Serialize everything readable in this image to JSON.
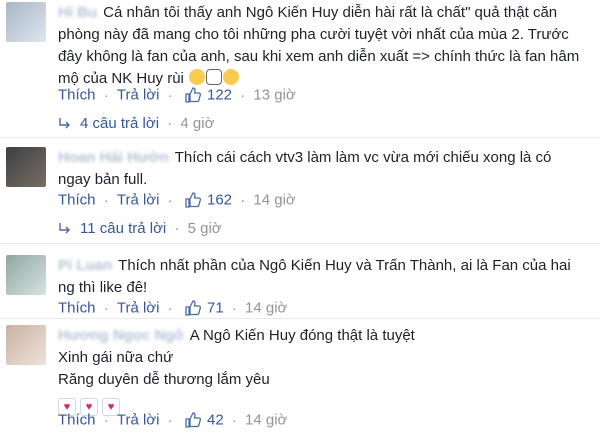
{
  "labels": {
    "like": "Thích",
    "reply": "Trả lời",
    "sep": "·"
  },
  "comments": [
    {
      "author": "Hi Bu",
      "lines": [
        "Cá nhân tôi thấy anh Ngô Kiến Huy diễn hài rất là chất\" quả thật căn",
        "phòng này đã mang cho tôi những pha cười tuyệt vời nhất của mùa 2. Trước",
        "đây không là fan của anh, sau khi xem anh diễn xuất => chính thức là fan hâm",
        "mộ của NK Huy rùi"
      ],
      "likes": "122",
      "time": "13 giờ",
      "replies": "4 câu trả lời",
      "replies_time": "4 giờ"
    },
    {
      "author": "Hoan Hải Hườn",
      "lines": [
        "Thích cái cách vtv3 làm làm vc vừa mới chiếu xong là có",
        "ngay bản full."
      ],
      "likes": "162",
      "time": "14 giờ",
      "replies": "11 câu trả lời",
      "replies_time": "5 giờ"
    },
    {
      "author": "Pi Luan",
      "lines": [
        "Thích nhất phần của Ngô Kiến Huy và Trấn Thành, ai là Fan của hai",
        "ng thì like đê!"
      ],
      "likes": "71",
      "time": "14 giờ"
    },
    {
      "author": "Hương Ngọc Ngô",
      "lines": [
        "A Ngô Kiến Huy đóng thật là tuyệt",
        "Xinh gái nữa chứ",
        "Răng duyên dễ thương lắm yêu"
      ],
      "likes": "42",
      "time": "14 giờ"
    }
  ],
  "colors": {
    "link": "#365899",
    "meta": "#90949c",
    "text": "#1d2129"
  }
}
